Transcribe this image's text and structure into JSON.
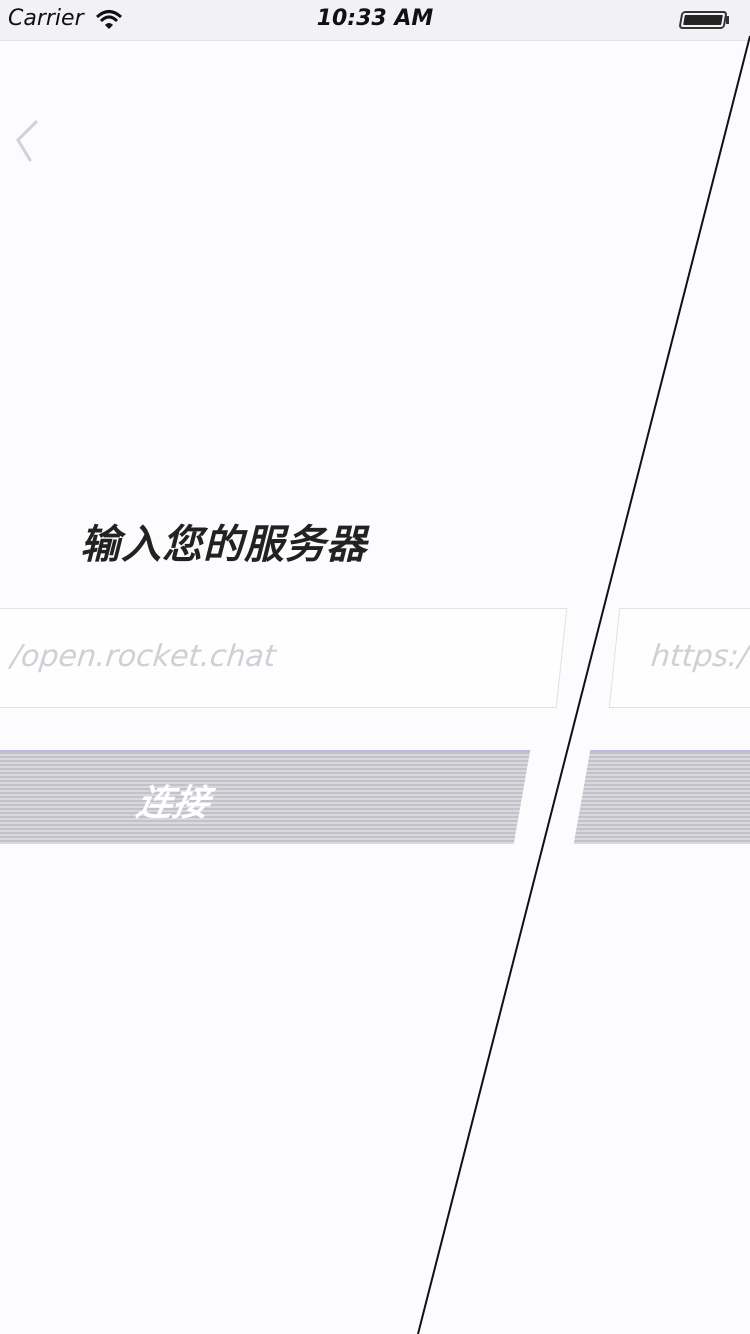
{
  "status_bar": {
    "carrier": "Carrier",
    "time": "10:33 AM"
  },
  "nav": {
    "back_icon": "chevron-left-icon"
  },
  "title": "输入您的服务器",
  "server_input": {
    "placeholder_left": "/open.rocket.chat",
    "placeholder_right": "https:/"
  },
  "connect_button": {
    "label": "连接"
  },
  "colors": {
    "background": "#fcfcfe",
    "button": "#c8c8ce",
    "placeholder": "#cfcfd6"
  }
}
